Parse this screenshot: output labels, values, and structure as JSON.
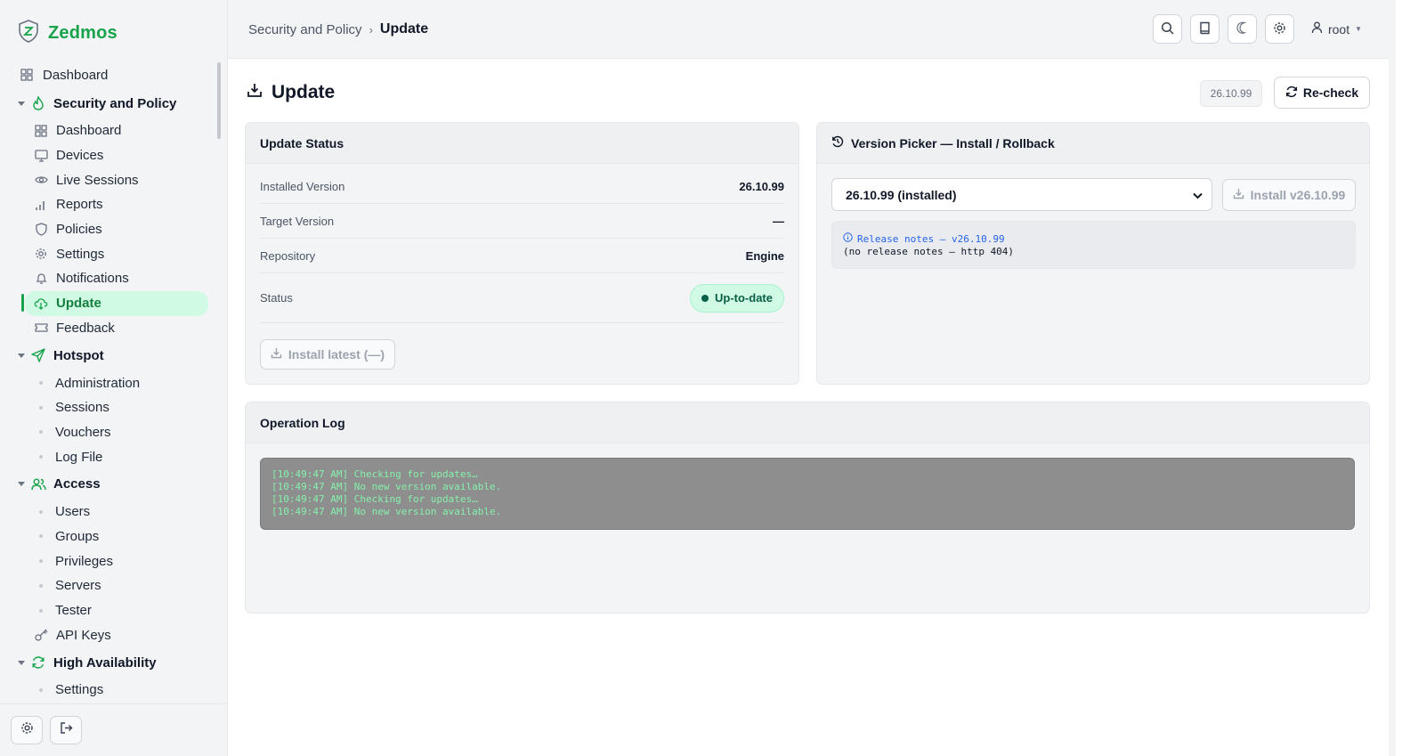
{
  "brand": {
    "name": "Zedmos"
  },
  "sidebar": {
    "top_item": {
      "label": "Dashboard",
      "icon": "grid-icon"
    },
    "groups": [
      {
        "label": "Security and Policy",
        "icon": "flame-icon",
        "items": [
          {
            "label": "Dashboard",
            "icon": "grid-icon"
          },
          {
            "label": "Devices",
            "icon": "monitor-icon"
          },
          {
            "label": "Live Sessions",
            "icon": "eye-icon"
          },
          {
            "label": "Reports",
            "icon": "bar-chart-icon"
          },
          {
            "label": "Policies",
            "icon": "shield-icon"
          },
          {
            "label": "Settings",
            "icon": "gear-icon"
          },
          {
            "label": "Notifications",
            "icon": "bell-icon"
          },
          {
            "label": "Update",
            "icon": "cloud-download-icon",
            "active": true
          },
          {
            "label": "Feedback",
            "icon": "ticket-icon"
          }
        ]
      },
      {
        "label": "Hotspot",
        "icon": "send-icon",
        "items": [
          {
            "label": "Administration"
          },
          {
            "label": "Sessions"
          },
          {
            "label": "Vouchers"
          },
          {
            "label": "Log File"
          }
        ]
      },
      {
        "label": "Access",
        "icon": "users-icon",
        "items": [
          {
            "label": "Users"
          },
          {
            "label": "Groups"
          },
          {
            "label": "Privileges"
          },
          {
            "label": "Servers"
          },
          {
            "label": "Tester"
          },
          {
            "label": "API Keys",
            "icon": "key-icon"
          }
        ]
      },
      {
        "label": "High Availability",
        "icon": "refresh-icon",
        "items": [
          {
            "label": "Settings"
          }
        ]
      }
    ]
  },
  "header": {
    "breadcrumb": {
      "parent": "Security and Policy",
      "separator": "›",
      "current": "Update"
    },
    "user": "root"
  },
  "main": {
    "title": "Update",
    "version_chip": "26.10.99",
    "recheck_label": "Re-check"
  },
  "status_card": {
    "title": "Update Status",
    "rows": [
      {
        "label": "Installed Version",
        "value": "26.10.99"
      },
      {
        "label": "Target Version",
        "value": "—"
      },
      {
        "label": "Repository",
        "value": "Engine"
      },
      {
        "label": "Status",
        "value": "Up-to-date"
      }
    ],
    "install_latest_label": "Install latest (—)"
  },
  "picker_card": {
    "title": "Version Picker — Install / Rollback",
    "selected_option": "26.10.99 (installed)",
    "install_label": "Install v26.10.99",
    "notes_link": "Release notes — v26.10.99",
    "notes_message": "(no release notes — http 404)"
  },
  "log_card": {
    "title": "Operation Log",
    "lines": [
      "[10:49:47 AM] Checking for updates…",
      "[10:49:47 AM] No new version available.",
      "[10:49:47 AM] Checking for updates…",
      "[10:49:47 AM] No new version available."
    ]
  },
  "colors": {
    "accent": "#16a34a",
    "active_bg": "#d1fae5",
    "log_bg": "#8e8e8e",
    "log_text": "#86efac"
  }
}
